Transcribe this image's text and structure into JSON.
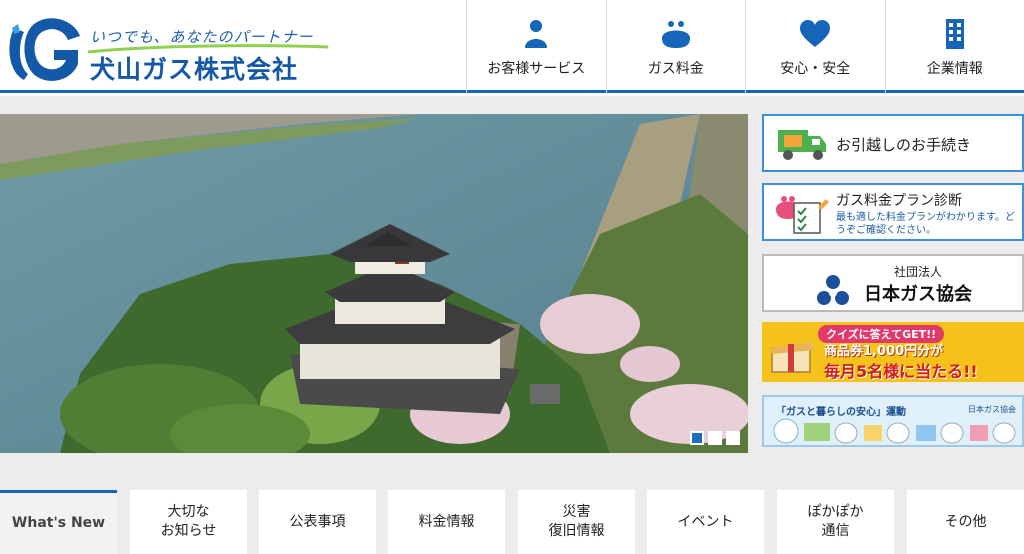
{
  "header": {
    "tagline": "いつでも、あなたのパートナー",
    "company_name": "犬山ガス株式会社"
  },
  "nav": [
    {
      "label": "お客様サービス",
      "icon": "person-icon"
    },
    {
      "label": "ガス料金",
      "icon": "purse-icon"
    },
    {
      "label": "安心・安全",
      "icon": "heart-icon"
    },
    {
      "label": "企業情報",
      "icon": "building-icon"
    }
  ],
  "hero": {
    "slides": 3,
    "active_slide": 1
  },
  "banners": {
    "moving": {
      "label": "お引越しのお手続き"
    },
    "plan": {
      "title": "ガス料金プラン診断",
      "subtitle": "最も適した料金プランがわかります。どうぞご確認ください。"
    },
    "association": {
      "top": "社団法人",
      "main": "日本ガス協会"
    },
    "quiz": {
      "tag": "クイズに答えてGET!!",
      "line1": "商品券1,000円分が",
      "line2": "毎月5名様に当たる!!"
    },
    "campaign": {
      "title": "「ガスと暮らしの安心」運動",
      "org": "日本ガス協会"
    }
  },
  "tabs": [
    {
      "label": "What's New"
    },
    {
      "label": "大切な\nお知らせ"
    },
    {
      "label": "公表事項"
    },
    {
      "label": "料金情報"
    },
    {
      "label": "災害\n復旧情報"
    },
    {
      "label": "イベント"
    },
    {
      "label": "ぽかぽか\n通信"
    },
    {
      "label": "その他"
    }
  ],
  "colors": {
    "brand_blue": "#1565b8",
    "banner_border": "#3a8fd6",
    "active_dot": "#1a6fc4"
  }
}
